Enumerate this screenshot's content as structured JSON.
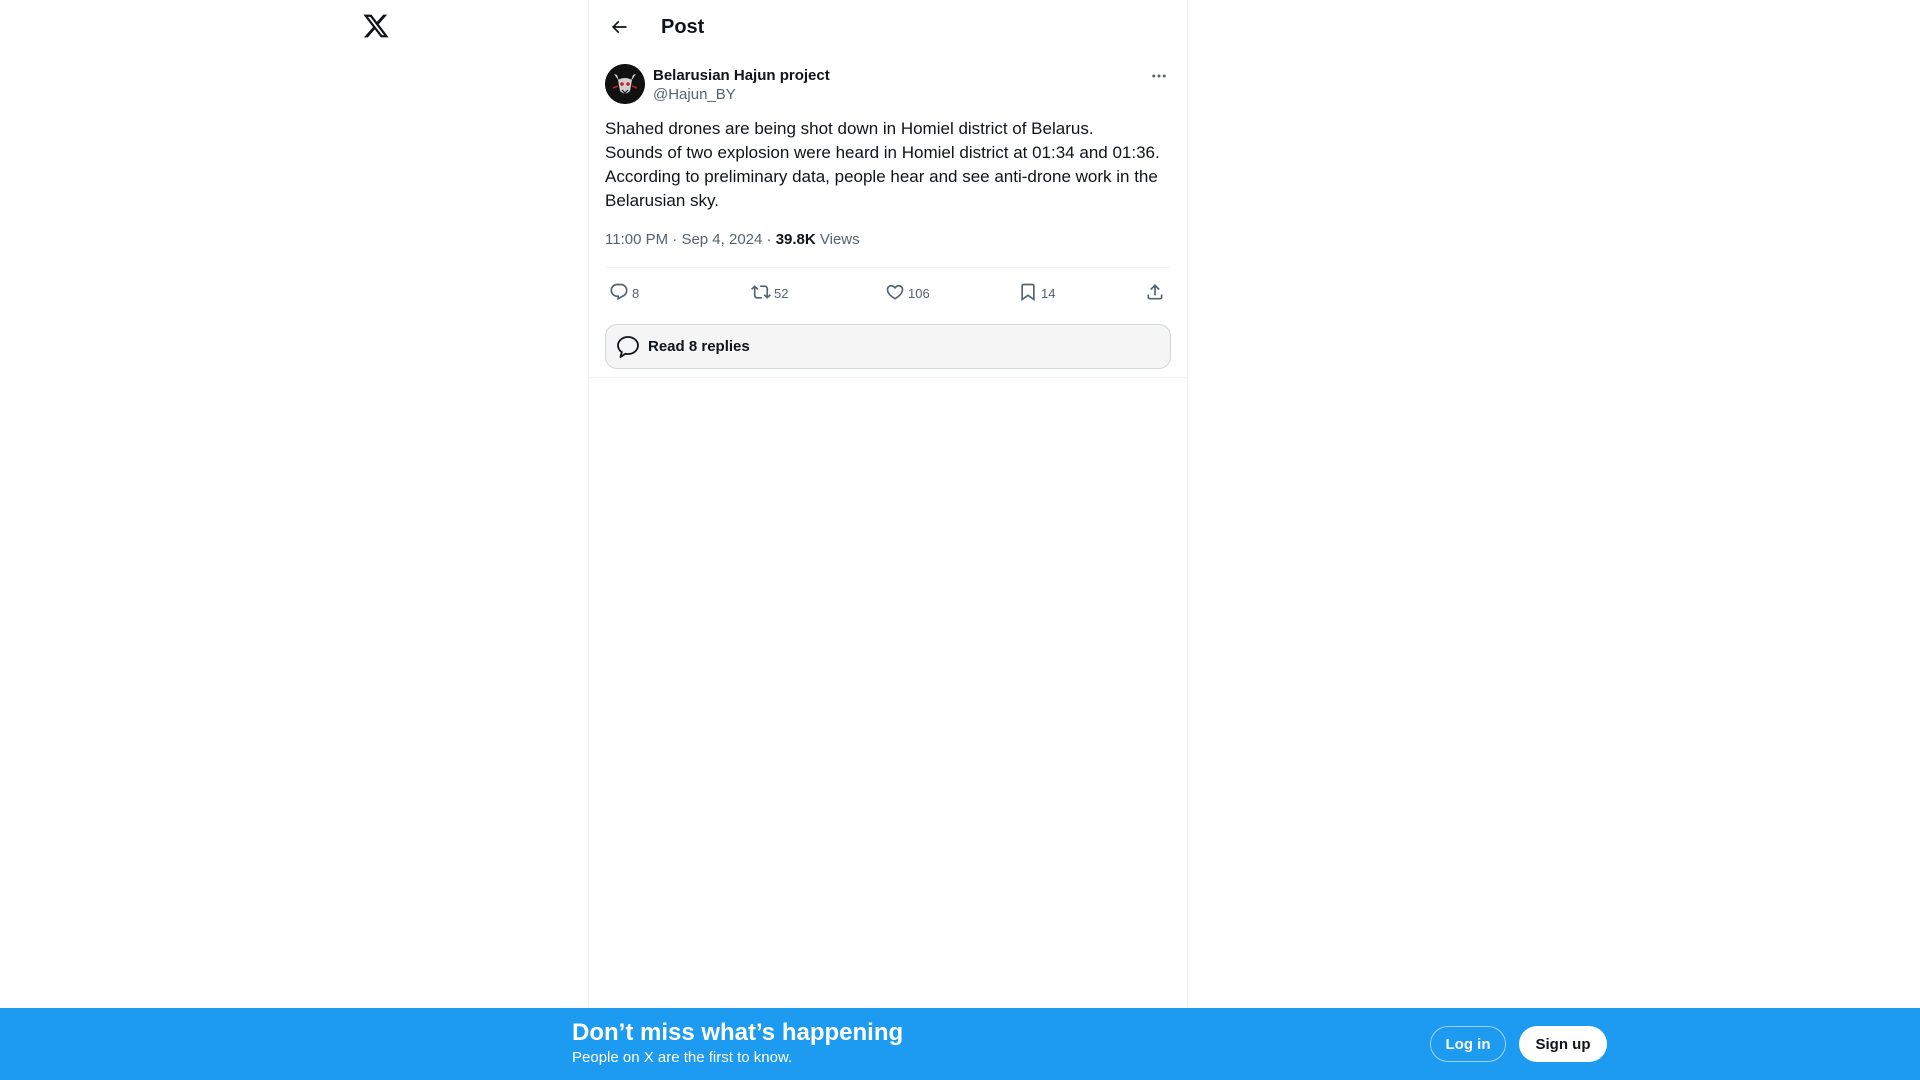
{
  "header": {
    "title": "Post"
  },
  "tweet": {
    "author_name": "Belarusian Hajun project",
    "author_handle": "@Hajun_BY",
    "text": "Shahed drones are being shot down in Homiel district of Belarus.\nSounds of two explosion were heard in Homiel district at 01:34 and 01:36. According to preliminary data, people hear and see anti-drone work in the Belarusian sky.",
    "time": "11:00 PM",
    "date": "Sep 4, 2024",
    "separator": "·",
    "views_count": "39.8K",
    "views_label": "Views"
  },
  "actions": {
    "replies": "8",
    "reposts": "52",
    "likes": "106",
    "bookmarks": "14"
  },
  "read_replies": {
    "label": "Read 8 replies"
  },
  "bottom_bar": {
    "title": "Don’t miss what’s happening",
    "subtitle": "People on X are the first to know.",
    "login_label": "Log in",
    "signup_label": "Sign up"
  },
  "icons": {
    "logo": "x-logo-icon",
    "back": "arrow-left-icon",
    "more": "more-horizontal-icon",
    "reply": "reply-icon",
    "repost": "repost-icon",
    "like": "heart-icon",
    "bookmark": "bookmark-icon",
    "share": "share-icon",
    "bubble": "chat-bubble-icon"
  },
  "colors": {
    "accent": "#1d9bf0",
    "text_primary": "#0f1419",
    "text_secondary": "#536471",
    "border": "#eff3f4"
  }
}
